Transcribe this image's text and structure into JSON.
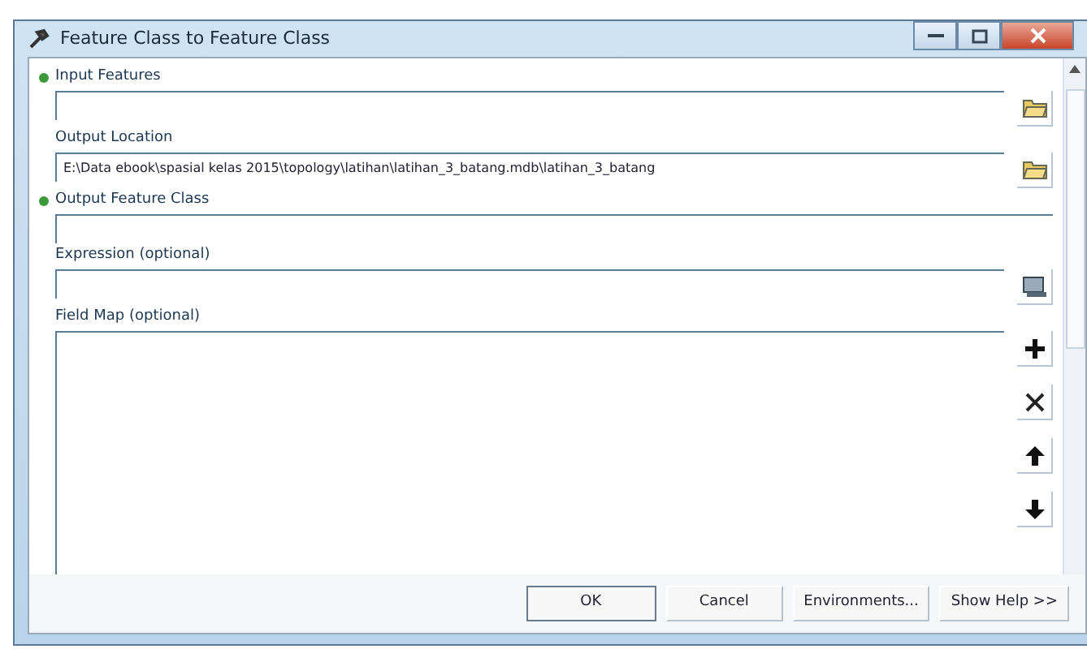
{
  "window": {
    "title": "Feature Class to Feature Class"
  },
  "parameters": [
    {
      "label": "Input Features",
      "required": true,
      "kind": "folder"
    },
    {
      "label": "Output Location",
      "required": false,
      "kind": "folder",
      "value": "E:\\Data ebook\\spasial kelas 2015\\topology\\latihan\\latihan_3_batang.mdb\\latihan_3_batang"
    },
    {
      "label": "Output Feature Class",
      "required": true,
      "kind": "plain"
    },
    {
      "label": "Expression (optional)",
      "required": false,
      "kind": "sql"
    },
    {
      "label": "Field Map (optional)",
      "required": false,
      "kind": "list"
    }
  ],
  "buttons": [
    {
      "label": "OK",
      "default": true
    },
    {
      "label": "Cancel",
      "default": false
    },
    {
      "label": "Environments...",
      "default": false
    },
    {
      "label": "Show Help >>",
      "default": false
    }
  ]
}
